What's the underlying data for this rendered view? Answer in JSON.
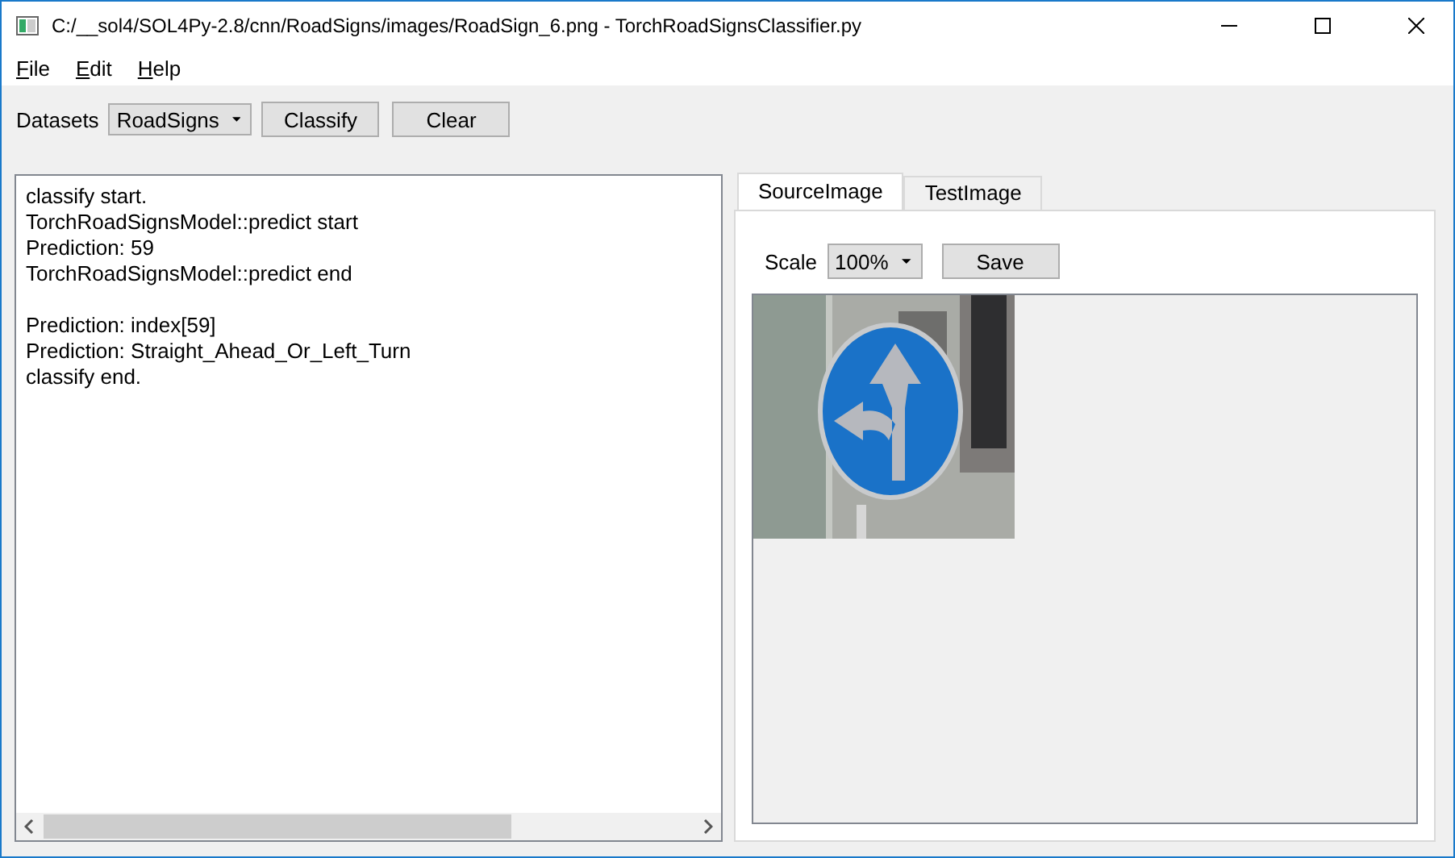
{
  "window": {
    "title": "C:/__sol4/SOL4Py-2.8/cnn/RoadSigns/images/RoadSign_6.png - TorchRoadSignsClassifier.py"
  },
  "menu": [
    "File",
    "Edit",
    "Help"
  ],
  "toolbar": {
    "label": "Datasets",
    "dataset": "RoadSigns",
    "buttons": [
      "Classify",
      "Clear"
    ]
  },
  "log": [
    {
      "lines": [
        "classify start.",
        "TorchRoadSignsModel::predict start",
        "Prediction: 59",
        "TorchRoadSignsModel::predict end"
      ]
    },
    {
      "lines": [
        "Prediction: index[59]",
        "Prediction: Straight_Ahead_Or_Left_Turn",
        "classify end."
      ]
    }
  ],
  "tabs": [
    {
      "label": "SourceImage",
      "selected": true
    },
    {
      "label": "TestImage",
      "selected": false
    }
  ],
  "image_panel": {
    "scale_label": "Scale",
    "scale": "100%",
    "save_button": "Save"
  }
}
